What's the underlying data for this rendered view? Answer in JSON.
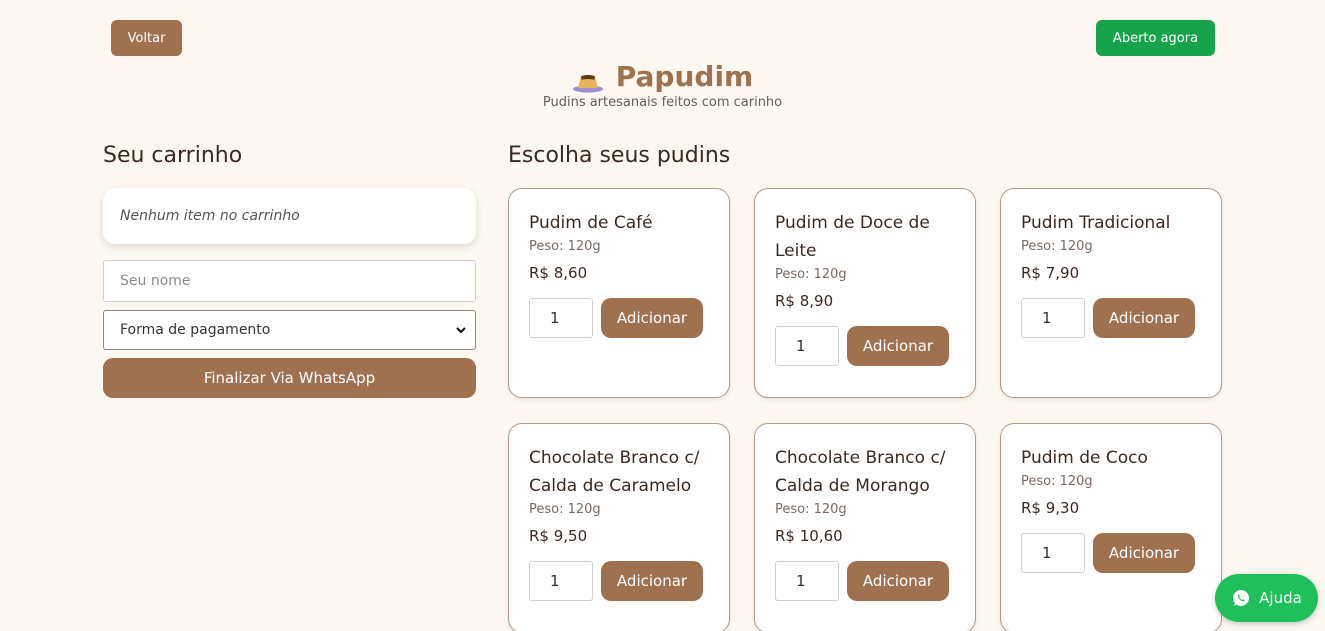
{
  "header": {
    "back_label": "Voltar",
    "status_label": "Aberto agora",
    "title": "Papudim",
    "subtitle": "Pudins artesanais feitos com carinho",
    "logo_icon": "pudim-icon"
  },
  "cart": {
    "title": "Seu carrinho",
    "empty_text": "Nenhum item no carrinho",
    "name_placeholder": "Seu nome",
    "payment_selected": "Forma de pagamento",
    "finish_label": "Finalizar Via WhatsApp"
  },
  "menu": {
    "title": "Escolha seus pudins",
    "add_label": "Adicionar",
    "products": [
      {
        "name": "Pudim de Café",
        "weight": "Peso: 120g",
        "price": "R$ 8,60",
        "qty": "1"
      },
      {
        "name": "Pudim de Doce de Leite",
        "weight": "Peso: 120g",
        "price": "R$ 8,90",
        "qty": "1"
      },
      {
        "name": "Pudim Tradicional",
        "weight": "Peso: 120g",
        "price": "R$ 7,90",
        "qty": "1"
      },
      {
        "name": "Chocolate Branco c/ Calda de Caramelo",
        "weight": "Peso: 120g",
        "price": "R$ 9,50",
        "qty": "1"
      },
      {
        "name": "Chocolate Branco c/ Calda de Morango",
        "weight": "Peso: 120g",
        "price": "R$ 10,60",
        "qty": "1"
      },
      {
        "name": "Pudim de Coco",
        "weight": "Peso: 120g",
        "price": "R$ 9,30",
        "qty": "1"
      }
    ]
  },
  "help": {
    "label": "Ajuda",
    "icon": "whatsapp-icon"
  },
  "colors": {
    "background": "#fcf7f1",
    "brand": "#a0714f",
    "open_status": "#17a34a",
    "whatsapp": "#1fbf5a"
  }
}
